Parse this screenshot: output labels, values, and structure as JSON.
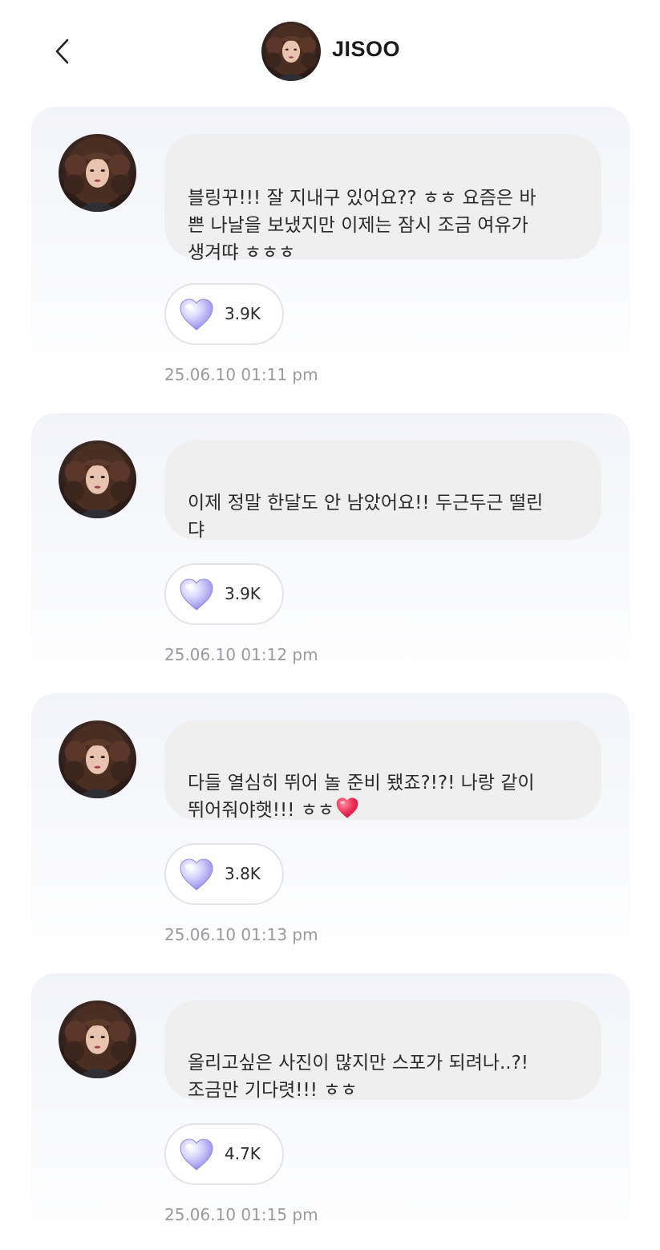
{
  "header": {
    "title": "JISOO",
    "back_icon": "chevron-left-icon"
  },
  "colors": {
    "bubble_bg": "#efefef",
    "card_bg": "#f3f4f9",
    "timestamp": "#9a9a9f",
    "heart_lilac": "#b9b3f2",
    "heart_red": "#ee2f55"
  },
  "messages": [
    {
      "text": "블링꾸!!! 잘 지내구 있어요?? ㅎㅎ 요즘은 바\n쁜 나날을 보냈지만 이제는 잠시 조금 여유가\n생겨땨 ㅎㅎㅎ",
      "likes": "3.9K",
      "time": "25.06.10 01:11 pm"
    },
    {
      "text": "이제 정말 한달도 안 남았어요!! 두근두근 떨린\n댜",
      "likes": "3.9K",
      "time": "25.06.10 01:12 pm"
    },
    {
      "text": "다들 열심히 뛰어 놀 준비 됐죠?!?! 나랑 같이\n뛰어줘야햇!!! ㅎㅎ",
      "emoji": "red-heart",
      "likes": "3.8K",
      "time": "25.06.10 01:13 pm"
    },
    {
      "text": "올리고싶은 사진이 많지만 스포가 되려나..?!\n조금만 기다렷!!! ㅎㅎ",
      "likes": "4.7K",
      "time": "25.06.10 01:15 pm"
    }
  ]
}
